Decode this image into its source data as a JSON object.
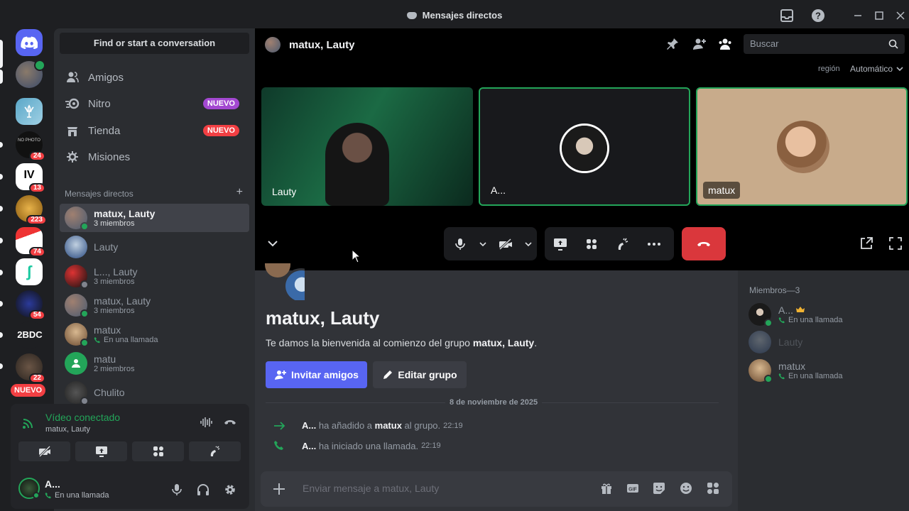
{
  "window": {
    "title": "Mensajes directos",
    "icons": [
      "inbox-icon",
      "help-icon",
      "minimize-icon",
      "maximize-icon",
      "close-icon"
    ]
  },
  "rail": {
    "servers": [
      {
        "name": "home",
        "badge": ""
      },
      {
        "name": "avatar-dm",
        "badge": ""
      },
      {
        "name": "server-lobster",
        "badge": ""
      },
      {
        "name": "server-no-photo",
        "badge": "24"
      },
      {
        "name": "server-iv",
        "badge": "13"
      },
      {
        "name": "server-gold",
        "badge": "223"
      },
      {
        "name": "server-santa",
        "badge": "74"
      },
      {
        "name": "server-j",
        "badge": ""
      },
      {
        "name": "server-urban",
        "badge": "54"
      },
      {
        "name": "server-2bdc",
        "badge": "",
        "text": "2BDC"
      },
      {
        "name": "server-face",
        "badge": "22"
      }
    ],
    "new_pill": "NUEVO"
  },
  "sidebar": {
    "find_label": "Find or start a conversation",
    "nav": [
      {
        "label": "Amigos",
        "icon": "friends-icon",
        "pill": ""
      },
      {
        "label": "Nitro",
        "icon": "nitro-icon",
        "pill": "NUEVO",
        "pill_color": "#a348d1"
      },
      {
        "label": "Tienda",
        "icon": "shop-icon",
        "pill": "NUEVO",
        "pill_color": "#f23f43"
      },
      {
        "label": "Misiones",
        "icon": "quests-icon",
        "pill": ""
      }
    ],
    "dm_header": "Mensajes directos",
    "dms": [
      {
        "name": "matux, Lauty",
        "sub": "3 miembros"
      },
      {
        "name": "Lauty",
        "sub": ""
      },
      {
        "name": "L..., Lauty",
        "sub": "3 miembros"
      },
      {
        "name": "matux, Lauty",
        "sub": "3 miembros"
      },
      {
        "name": "matux",
        "sub": "En una llamada"
      },
      {
        "name": "matu",
        "sub": "2 miembros"
      },
      {
        "name": "Chulito",
        "sub": ""
      }
    ]
  },
  "voice": {
    "status": "Vídeo conectado",
    "channel": "matux, Lauty"
  },
  "user": {
    "name": "A...",
    "status": "En una llamada"
  },
  "call": {
    "header": "matux, Lauty",
    "search_placeholder": "Buscar",
    "region_label": "región",
    "region_value": "Automático",
    "tiles": [
      {
        "name": "Lauty"
      },
      {
        "name": "A..."
      },
      {
        "name": "matux"
      }
    ]
  },
  "channel": {
    "title": "matux, Lauty",
    "welcome_prefix": "Te damos la bienvenida al comienzo del grupo ",
    "welcome_group": "matux, Lauty",
    "welcome_suffix": ".",
    "invite_label": "Invitar amigos",
    "edit_label": "Editar grupo",
    "date_divider": "8 de noviembre de 2025",
    "messages": [
      {
        "actor": "A...",
        "text1": " ha añadido a ",
        "target": "matux",
        "text2": " al grupo.",
        "time": "22:19"
      },
      {
        "actor": "A...",
        "text1": " ha iniciado una llamada.",
        "target": "",
        "text2": "",
        "time": "22:19"
      }
    ],
    "composer_placeholder": "Enviar mensaje a matux, Lauty"
  },
  "members": {
    "header": "Miembros—3",
    "list": [
      {
        "name": "A...",
        "status": "En una llamada"
      },
      {
        "name": "Lauty",
        "status": ""
      },
      {
        "name": "matux",
        "status": "En una llamada"
      }
    ]
  },
  "colors": {
    "accent": "#5865f2",
    "online": "#23a559",
    "danger": "#da373c",
    "voice_green": "#23a559"
  }
}
